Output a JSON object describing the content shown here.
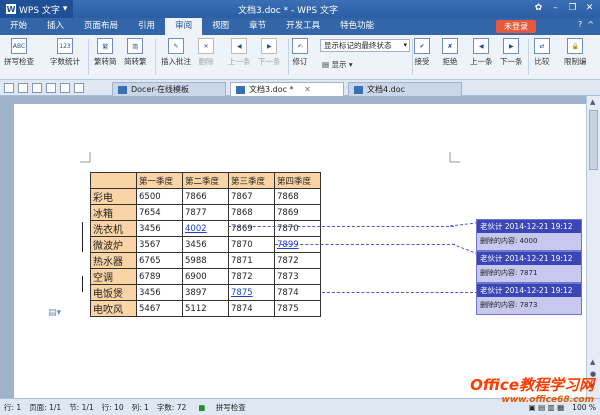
{
  "titlebar": {
    "app_name": "WPS 文字",
    "title": "文档3.doc * - WPS 文字"
  },
  "menubar": {
    "items": [
      "开始",
      "插入",
      "页面布局",
      "引用",
      "审阅",
      "视图",
      "章节",
      "开发工具",
      "特色功能"
    ],
    "active": "审阅",
    "login": "未登录"
  },
  "ribbon": {
    "spell_check": "拼写检查",
    "word_count": "字数统计",
    "trad_to_simp": "繁转简",
    "simp_to_trad": "简转繁",
    "insert_comment": "插入批注",
    "delete": "删除",
    "prev": "上一条",
    "next": "下一条",
    "revise": "修订",
    "markup_select": "显示标记的最终状态",
    "show": "显示",
    "accept": "接受",
    "reject": "拒绝",
    "prev2": "上一条",
    "next2": "下一条",
    "compare": "比较",
    "restrict": "限制编"
  },
  "tabs": [
    {
      "label": "Docer-在线模板"
    },
    {
      "label": "文档3.doc *"
    },
    {
      "label": "文档4.doc"
    }
  ],
  "table": {
    "headers": [
      "",
      "第一季度",
      "第二季度",
      "第三季度",
      "第四季度"
    ],
    "rows": [
      {
        "name": "彩电",
        "q1": "6500",
        "q2": "7866",
        "q3": "7867",
        "q4": "7868"
      },
      {
        "name": "冰箱",
        "q1": "7654",
        "q2": "7877",
        "q3": "7868",
        "q4": "7869"
      },
      {
        "name": "洗衣机",
        "q1": "3456",
        "q2": "4002",
        "q3": "7869",
        "q4": "7870"
      },
      {
        "name": "微波炉",
        "q1": "3567",
        "q2": "3456",
        "q3": "7870",
        "q4": "7899"
      },
      {
        "name": "热水器",
        "q1": "6765",
        "q2": "5988",
        "q3": "7871",
        "q4": "7872"
      },
      {
        "name": "空调",
        "q1": "6789",
        "q2": "6900",
        "q3": "7872",
        "q4": "7873"
      },
      {
        "name": "电饭煲",
        "q1": "3456",
        "q2": "3897",
        "q3": "7875",
        "q4": "7874"
      },
      {
        "name": "电吹风",
        "q1": "5467",
        "q2": "5112",
        "q3": "7874",
        "q4": "7875"
      }
    ]
  },
  "comments": [
    {
      "header": "老伙计  2014-12-21 19:12",
      "text": "删除的内容: 4000"
    },
    {
      "header": "老伙计  2014-12-21 19:12",
      "text": "删除的内容: 7871"
    },
    {
      "header": "老伙计  2014-12-21 19:12",
      "text": "删除的内容: 7873"
    }
  ],
  "statusbar": {
    "row": "行: 1",
    "page": "页面: 1/1",
    "section": "节: 1/1",
    "line": "行: 10",
    "col": "列: 1",
    "words": "字数: 72",
    "spell": "拼写检查",
    "zoom": "100 %"
  },
  "watermark": {
    "title": "Office教程学习网",
    "url": "www.office68.com"
  }
}
